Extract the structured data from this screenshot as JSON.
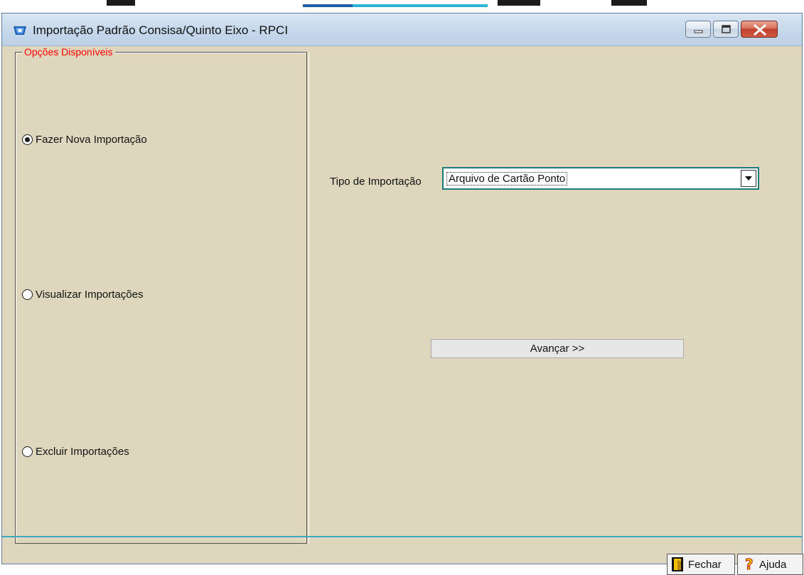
{
  "window": {
    "title": "Importação Padrão Consisa/Quinto Eixo - RPCI",
    "icons": [
      "app-icon",
      "minimize-icon",
      "maximize-icon",
      "close-icon"
    ]
  },
  "options_group": {
    "legend": "Opções Disponíveis",
    "radios": [
      {
        "label": "Fazer Nova Importação",
        "checked": true
      },
      {
        "label": "Visualizar Importações",
        "checked": false
      },
      {
        "label": "Excluir Importações",
        "checked": false
      }
    ],
    "legend_color": "#ff0000"
  },
  "import_type": {
    "label": "Tipo de Importação",
    "selected": "Arquivo de Cartão Ponto"
  },
  "actions": {
    "advance_label": "Avançar >>"
  },
  "footer": {
    "close_label": "Fechar",
    "help_label": "Ajuda",
    "close_icon": "exit-door-icon",
    "help_icon": "question-mark-icon"
  },
  "colors": {
    "background": "#ded7be",
    "combo_border": "#1e7b78",
    "separator": "#3aa9c2"
  }
}
